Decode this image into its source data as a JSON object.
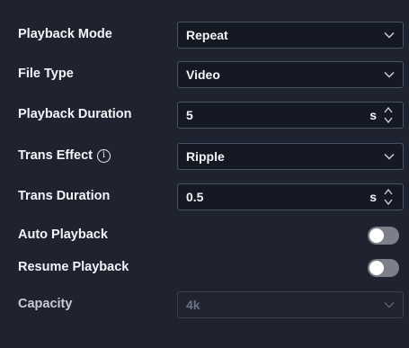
{
  "settings": {
    "playback_mode": {
      "label": "Playback Mode",
      "value": "Repeat"
    },
    "file_type": {
      "label": "File Type",
      "value": "Video"
    },
    "playback_duration": {
      "label": "Playback Duration",
      "value": "5",
      "unit": "s"
    },
    "trans_effect": {
      "label": "Trans Effect",
      "value": "Ripple",
      "info_icon": "info-circle-icon"
    },
    "trans_duration": {
      "label": "Trans Duration",
      "value": "0.5",
      "unit": "s"
    },
    "auto_playback": {
      "label": "Auto Playback",
      "enabled": false
    },
    "resume_playback": {
      "label": "Resume Playback",
      "enabled": false
    },
    "capacity": {
      "label": "Capacity",
      "value": "4k",
      "disabled": true
    }
  },
  "colors": {
    "background": "#1f2330",
    "control_background": "#151923",
    "control_border": "#4a5266",
    "text": "#f2f4f8",
    "toggle_off": "#7b7f88",
    "disabled_text": "#6c7383"
  }
}
